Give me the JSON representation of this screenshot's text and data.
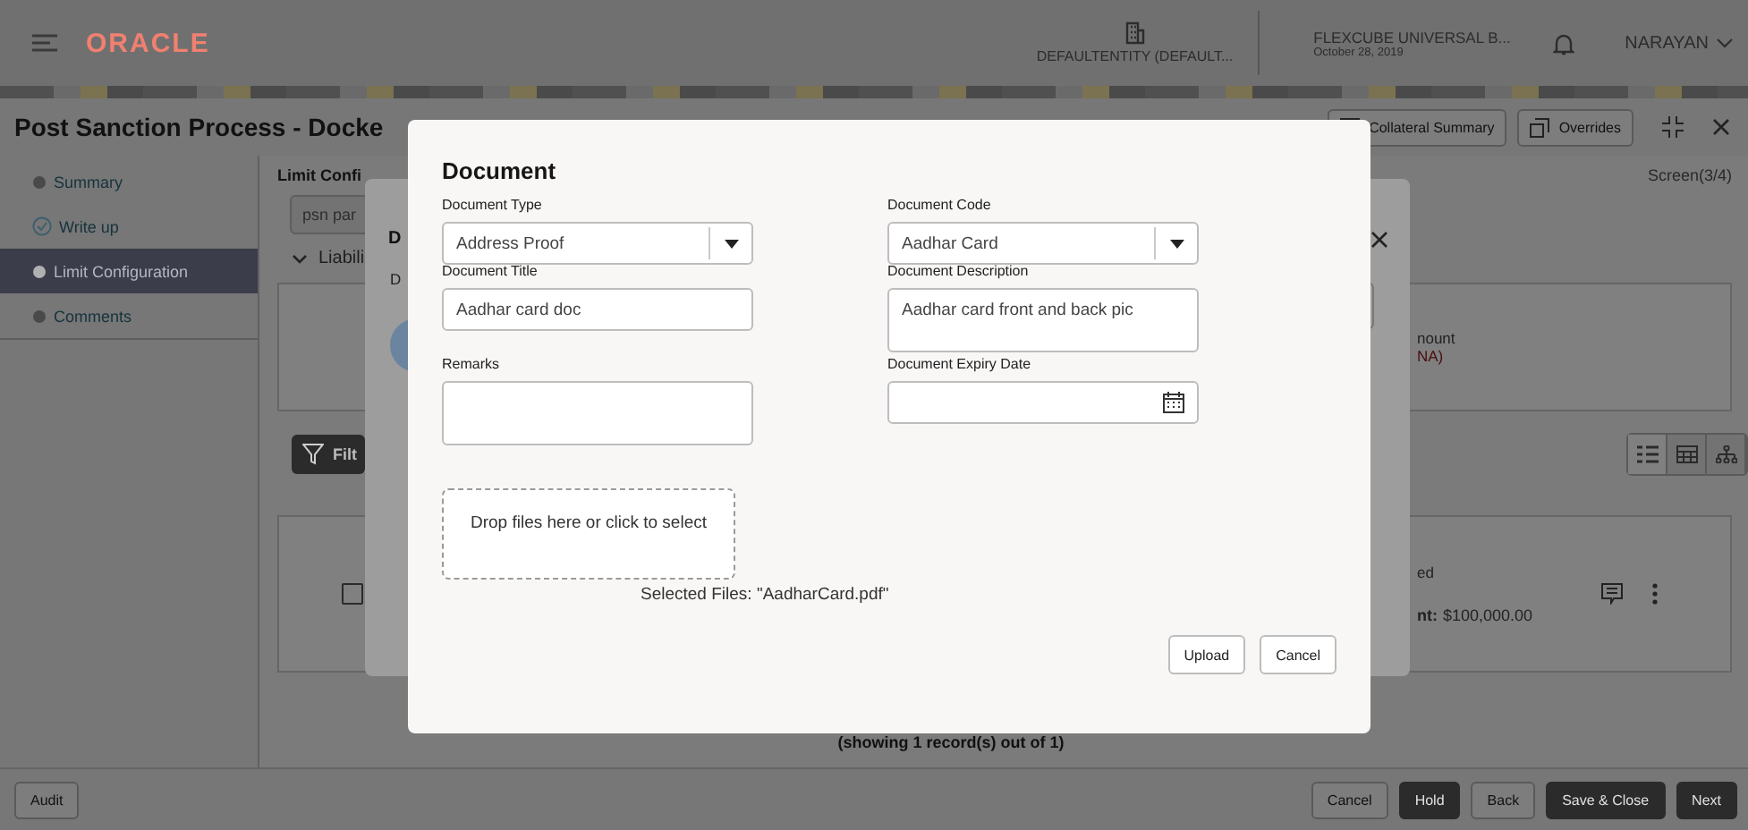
{
  "header": {
    "brand": "ORACLE",
    "entity": "DEFAULTENTITY (DEFAULT...",
    "app_name": "FLEXCUBE UNIVERSAL B...",
    "date": "October 28, 2019",
    "user": "NARAYAN"
  },
  "page": {
    "title": "Post Sanction Process - Docke",
    "actions": [
      {
        "label": "Collateral Summary",
        "kind": "collateral"
      },
      {
        "label": "Overrides",
        "kind": "overrides"
      }
    ],
    "screen_counter": "Screen(3/4)"
  },
  "sidebar": {
    "items": [
      {
        "label": "Summary",
        "selected": false,
        "completed": false
      },
      {
        "label": "Write up",
        "selected": false,
        "completed": true
      },
      {
        "label": "Limit Configuration",
        "selected": true,
        "completed": false
      },
      {
        "label": "Comments",
        "selected": false,
        "completed": false
      }
    ]
  },
  "main": {
    "section_title": "Limit Confi",
    "search_value": "psn par",
    "group_title": "Liabili",
    "summary_label": "nount",
    "summary_value": "NA)",
    "filter_label": "Filt",
    "view_options": [
      {
        "kind": "list",
        "selected": true
      },
      {
        "kind": "table",
        "selected": false
      },
      {
        "kind": "tree",
        "selected": false
      }
    ],
    "record": {
      "checked": false,
      "status": "ed",
      "amount_label": "nt:",
      "amount": "$100,000.00"
    },
    "record_count": "(showing 1 record(s) out of 1)"
  },
  "background_dialog": {
    "heading": "D",
    "subheading": "D"
  },
  "dialog": {
    "title": "Document",
    "fields": [
      {
        "label": "Document Type",
        "kind": "select",
        "value": "Address Proof"
      },
      {
        "label": "Document Code",
        "kind": "select",
        "value": "Aadhar Card"
      },
      {
        "label": "Document Title",
        "kind": "text",
        "value": "Aadhar card doc"
      },
      {
        "label": "Document Description",
        "kind": "textarea",
        "value": "Aadhar card front and back  pic"
      },
      {
        "label": "Remarks",
        "kind": "textarea"
      },
      {
        "label": "Document Expiry Date",
        "kind": "date"
      }
    ],
    "dropzone": "Drop files here or click to select",
    "selected_files": "Selected Files: \"AadharCard.pdf\"",
    "buttons": [
      "Upload",
      "Cancel"
    ]
  },
  "footer": {
    "left_buttons": [
      "Audit"
    ],
    "buttons": [
      {
        "label": "Cancel",
        "primary": false
      },
      {
        "label": "Hold",
        "primary": true
      },
      {
        "label": "Back",
        "primary": false
      },
      {
        "label": "Save & Close",
        "primary": true
      },
      {
        "label": "Next",
        "primary": true
      }
    ]
  }
}
